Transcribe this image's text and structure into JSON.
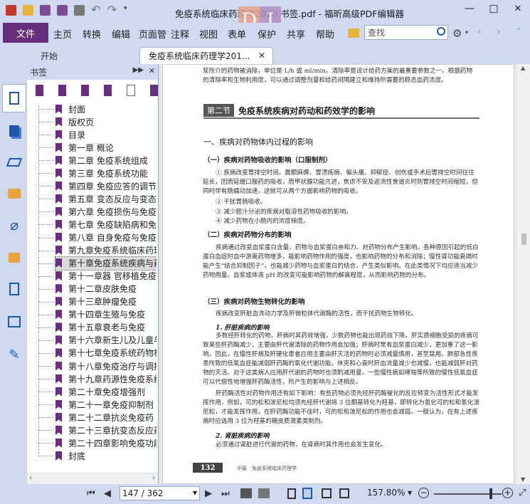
{
  "window": {
    "title": "免疫系统临床药理学2010 书签.pdf - 福昕高级PDF编辑器",
    "logo_letters": "DI",
    "minimize": "—",
    "restore": "□",
    "close": "✕"
  },
  "menu": {
    "file": "文件",
    "items": [
      "主页",
      "转换",
      "编辑",
      "页面管",
      "注释",
      "视图",
      "表单",
      "保护",
      "共享",
      "帮助"
    ],
    "search_placeholder": "查找"
  },
  "tabs": [
    {
      "label": "开始"
    },
    {
      "label": "免疫系统临床药理学201..."
    }
  ],
  "bookmarks": {
    "header": "书签",
    "items": [
      "封面",
      "版权页",
      "目录",
      "第一章 概论",
      "第二章 免疫系统组成",
      "第三章 免疫系统功能",
      "第四章 免疫应答的调节",
      "第五章 变态反应与变态反应",
      "第六章 免疫损伤与免疫性疾",
      "第七章 免疫缺陷病和免疫",
      "第八章 自身免疫与免疫耐",
      "第九章免疫系统临床药理学",
      "第十章免疫系统疾病与药物",
      "第十一章器 官移植免疫",
      "第十二章皮肤免疫",
      "第十三章肿瘤免疫",
      "第十四章生殖与免疫",
      "第十五章衰老与免疫",
      "第十六章新生儿及儿童与免",
      "第十七章免疫系统药物相互",
      "第十八章免疫治疗与调控",
      "第十九章药源性免疫系统疾",
      "第二十章免疫增强剂",
      "第二十一章免疫抑制剂",
      "第二十二章抗炎免疫药",
      "第二十三章抗变态反应药",
      "第二十四章影响免疫功能的",
      "封底"
    ],
    "selected_index": 12
  },
  "document": {
    "top_lines": [
      "浆所介的药物被消除，单位是 L/h 或 ml/min。清除率是设计给药方案的最重要参数之一。根据药物",
      "的清除率和生物利用度，可以通过调整剂量和给药间隔建立和维持所需要的稳态血药浓度。"
    ],
    "section_box": "第二节",
    "section_title": "免疫系统疾病对药动和药效学的影响",
    "h1": "一、疾病对药物体内过程的影响",
    "sub1": "（一）疾病对药物吸收的影响（口服制剂）",
    "para1": "① 疾病改变胃排空时间。震颤麻痹、胃溃疡病、偏头痛、抑郁症、创伤或手术后胃排空时间往往延长，因而延缓口服药的吸收，而甲状腺功能亢进，焦虑不安及返流性食道炎时则胃排空时间缩短，但同时伴有肠蠕动加速，这就可从两个方面影响药物的吸收。",
    "list1": [
      "② 干扰胃肠吸收。",
      "③ 减少胆汁分泌的疾病对脂溶性药物吸收的影响。",
      "④ 减少药物在小肠内的浓度梯度。"
    ],
    "sub2": "（二）疾病对药物分布的影响",
    "para2": "疾病通过改变血浆蛋白含量、药物与血浆蛋白亲和力、对药物分布产生影响。各种原因引起的低白蛋白血症时血中游离药物增多，能影响药物作用的强度，也影响药物的分布和消除；慢性肾功能衰竭时能产生“结合抑制因子”，也能减少药物与血浆蛋白的结合，产生类似影响。在此类情况下均应适当减少药物用量。血浆或体液 pH 的改变可能影响药物的解离程度，从而影响药物的分布。",
    "sub3": "（三）疾病对药物生物转化的影响",
    "para3": "疾病改变肝脏血流动力学及肝微粒体代谢酶的活性，而干扰药物生物转化。",
    "sub3_1": "1. 肝脏疾病的影响",
    "para4": "多数经肝转化的药物，肝病时其药效增强，少数药物也能出现药效下降。肝实质细胞受损的疾病可致某些肝药酶减少，主要由肝代谢清除的药物作用会加强；肝病时常有血浆蛋白减少，更加重了这一影响。因此，在慢性肝病及肝硬化患者应用主要由肝灭活的药物时必须减量慎用，甚至禁用。肺部急性疾患所致的低氧血症能减弱肝药酶的氧化代谢功能。休克和心衰时肝血流量减少也减慢，也能减弱肝对药物的灭活。对于这类病人应用肝代谢的药物时也须酌减用量。一些慢性病如哮喘等所致的慢性低氧血症可以代偿性地增强肝药酶活性，所产生的影响与上述相反。",
    "para5": "肝药酶活性对药物作用还有如下影响：有些药物必须先经肝药酶催化的反应转变为活性形式才能发挥作用，例如，可的松和泼尼松均须先经肝代谢将 3 位酮基转化为羟基，即转化为氢化可的松和氢化泼尼松，才能发挥作用，在肝药酶功能不佳时，可的松和泼尼松的作用也会减弱。一般认为，在有上述疾病时应选用 3 位为羟基的糖皮质激素类制剂。",
    "sub3_2": "2. 肾脏疾病的影响",
    "para6": "必须通过肾脏进行代谢的药物，在肾病时其作用也会发生变化。",
    "page_number": "132",
    "footer": "中篇　免疫系统临床药理学"
  },
  "status": {
    "page_display": "147 / 362",
    "zoom": "157.80%",
    "zoom_minus": "−",
    "zoom_plus": "+"
  }
}
